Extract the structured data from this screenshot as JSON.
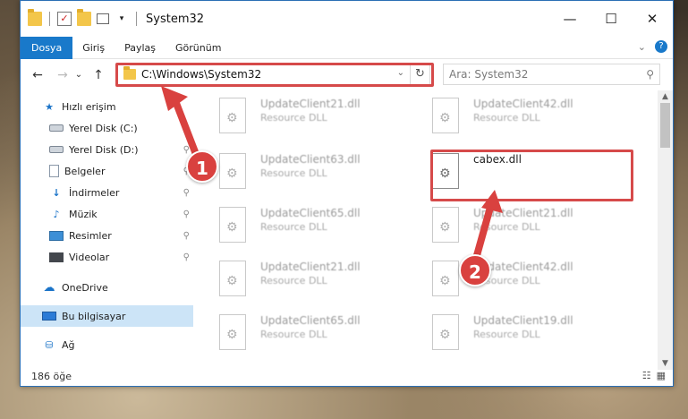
{
  "window": {
    "title": "System32",
    "quick_access_icons": [
      "folder-icon",
      "properties-icon",
      "new-folder-icon",
      "view-icon",
      "dropdown-icon"
    ],
    "controls": {
      "minimize": "—",
      "maximize": "☐",
      "close": "✕"
    }
  },
  "ribbon": {
    "tabs": [
      {
        "label": "Dosya",
        "active": true
      },
      {
        "label": "Giriş"
      },
      {
        "label": "Paylaş"
      },
      {
        "label": "Görünüm"
      }
    ],
    "expand_glyph": "⌄",
    "help_glyph": "?"
  },
  "navigation": {
    "back_glyph": "←",
    "forward_glyph": "→",
    "recent_glyph": "⌄",
    "up_glyph": "↑",
    "address_path": "C:\\Windows\\System32",
    "address_dropdown_glyph": "⌄",
    "refresh_glyph": "↻",
    "search_placeholder": "Ara: System32",
    "search_glyph": "⚲"
  },
  "sidebar": {
    "items": [
      {
        "label": "Hızlı erişim",
        "icon": "star-icon",
        "pinned": false
      },
      {
        "label": "Yerel Disk (C:)",
        "icon": "drive-icon",
        "pinned": true
      },
      {
        "label": "Yerel Disk (D:)",
        "icon": "drive-icon",
        "pinned": true
      },
      {
        "label": "Belgeler",
        "icon": "document-icon",
        "pinned": true
      },
      {
        "label": "İndirmeler",
        "icon": "download-icon",
        "pinned": true
      },
      {
        "label": "Müzik",
        "icon": "music-icon",
        "pinned": true
      },
      {
        "label": "Resimler",
        "icon": "pictures-icon",
        "pinned": true
      },
      {
        "label": "Videolar",
        "icon": "videos-icon",
        "pinned": true
      },
      {
        "label": "OneDrive",
        "icon": "cloud-icon",
        "pinned": false
      },
      {
        "label": "Bu bilgisayar",
        "icon": "computer-icon",
        "pinned": false,
        "selected": true
      },
      {
        "label": "Ağ",
        "icon": "network-icon",
        "pinned": false
      }
    ],
    "pin_glyph": "📌"
  },
  "files": [
    {
      "name": "UpdateClient21.dll",
      "type": "Resource DLL"
    },
    {
      "name": "UpdateClient42.dll",
      "type": "Resource DLL"
    },
    {
      "name": "UpdateClient63.dll",
      "type": "Resource DLL"
    },
    {
      "name": "cabex.dll",
      "type": ""
    },
    {
      "name": "UpdateClient65.dll",
      "type": "Resource DLL"
    },
    {
      "name": "UpdateClient21.dll",
      "type": "Resource DLL"
    },
    {
      "name": "UpdateClient21.dll",
      "type": "Resource DLL"
    },
    {
      "name": "UpdateClient42.dll",
      "type": "Resource DLL"
    },
    {
      "name": "UpdateClient65.dll",
      "type": "Resource DLL"
    },
    {
      "name": "UpdateClient19.dll",
      "type": "Resource DLL"
    }
  ],
  "status": {
    "item_count": "186 öğe",
    "details_view_glyph": "☷",
    "icons_view_glyph": "▦"
  },
  "annotations": {
    "step1": "1",
    "step2": "2",
    "color": "#d9413f"
  },
  "scrollbar": {
    "up_glyph": "▲",
    "down_glyph": "▼"
  }
}
